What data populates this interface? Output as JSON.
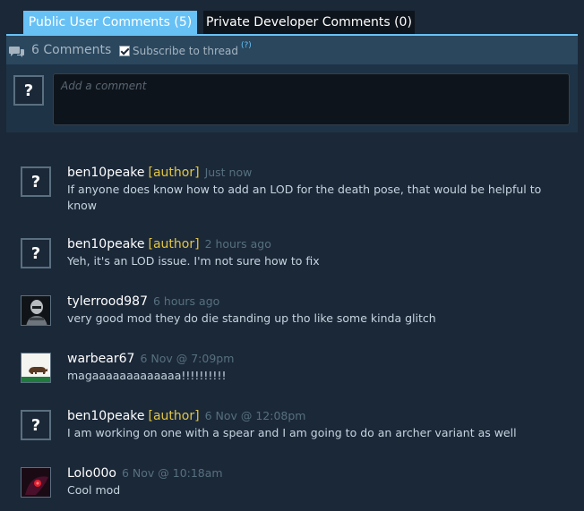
{
  "tabs": {
    "public_label": "Public User Comments (5)",
    "private_label": "Private Developer Comments (0)"
  },
  "header": {
    "comment_count": "6 Comments",
    "subscribe_label": "Subscribe to thread",
    "help_marker": "(?)"
  },
  "compose": {
    "placeholder": "Add a comment"
  },
  "comments": [
    {
      "author": "ben10peake",
      "tag": "[author]",
      "time": "Just now",
      "text": "If anyone does know how to add an LOD for the death pose, that would be helpful to know",
      "avatar": "question-mark"
    },
    {
      "author": "ben10peake",
      "tag": "[author]",
      "time": "2 hours ago",
      "text": "Yeh, it's an LOD issue. I'm not sure how to fix",
      "avatar": "question-mark"
    },
    {
      "author": "tylerrood987",
      "tag": "",
      "time": "6 hours ago",
      "text": "very good mod they do die standing up tho like some kinda glitch",
      "avatar": "soldier"
    },
    {
      "author": "warbear67",
      "tag": "",
      "time": "6 Nov @ 7:09pm",
      "text": "magaaaaaaaaaaaaa!!!!!!!!!!",
      "avatar": "bear-flag"
    },
    {
      "author": "ben10peake",
      "tag": "[author]",
      "time": "6 Nov @ 12:08pm",
      "text": "I am working on one with a spear and I am going to do an archer variant as well",
      "avatar": "question-mark"
    },
    {
      "author": "Lolo00o",
      "tag": "",
      "time": "6 Nov @ 10:18am",
      "text": "Cool mod",
      "avatar": "red-eye"
    }
  ],
  "colors": {
    "background": "#1b2838",
    "tab_active": "#67c1f5",
    "author_tag": "#e2c643",
    "timestamp": "#56707f"
  }
}
